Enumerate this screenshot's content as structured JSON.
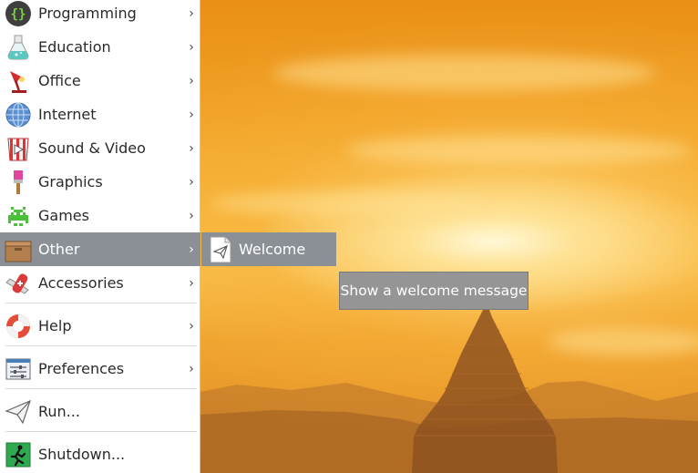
{
  "menu": {
    "items": [
      {
        "label": "Programming",
        "icon": "programming-icon",
        "has_submenu": true
      },
      {
        "label": "Education",
        "icon": "education-icon",
        "has_submenu": true
      },
      {
        "label": "Office",
        "icon": "office-icon",
        "has_submenu": true
      },
      {
        "label": "Internet",
        "icon": "internet-icon",
        "has_submenu": true
      },
      {
        "label": "Sound & Video",
        "icon": "sound-video-icon",
        "has_submenu": true
      },
      {
        "label": "Graphics",
        "icon": "graphics-icon",
        "has_submenu": true
      },
      {
        "label": "Games",
        "icon": "games-icon",
        "has_submenu": true
      },
      {
        "label": "Other",
        "icon": "other-icon",
        "has_submenu": true,
        "active": true
      },
      {
        "label": "Accessories",
        "icon": "accessories-icon",
        "has_submenu": true
      },
      {
        "label": "Help",
        "icon": "help-icon",
        "has_submenu": true
      },
      {
        "label": "Preferences",
        "icon": "preferences-icon",
        "has_submenu": true
      },
      {
        "label": "Run...",
        "icon": "run-icon",
        "has_submenu": false
      },
      {
        "label": "Shutdown...",
        "icon": "shutdown-icon",
        "has_submenu": false
      }
    ],
    "submenu_arrow": "›"
  },
  "submenu": {
    "items": [
      {
        "label": "Welcome",
        "icon": "welcome-icon"
      }
    ]
  },
  "tooltip": {
    "text": "Show a welcome message"
  },
  "colors": {
    "menu_bg": "#ffffff",
    "highlight": "#8a9096",
    "tooltip_bg": "#959595",
    "sky_orange": "#f0a126"
  }
}
